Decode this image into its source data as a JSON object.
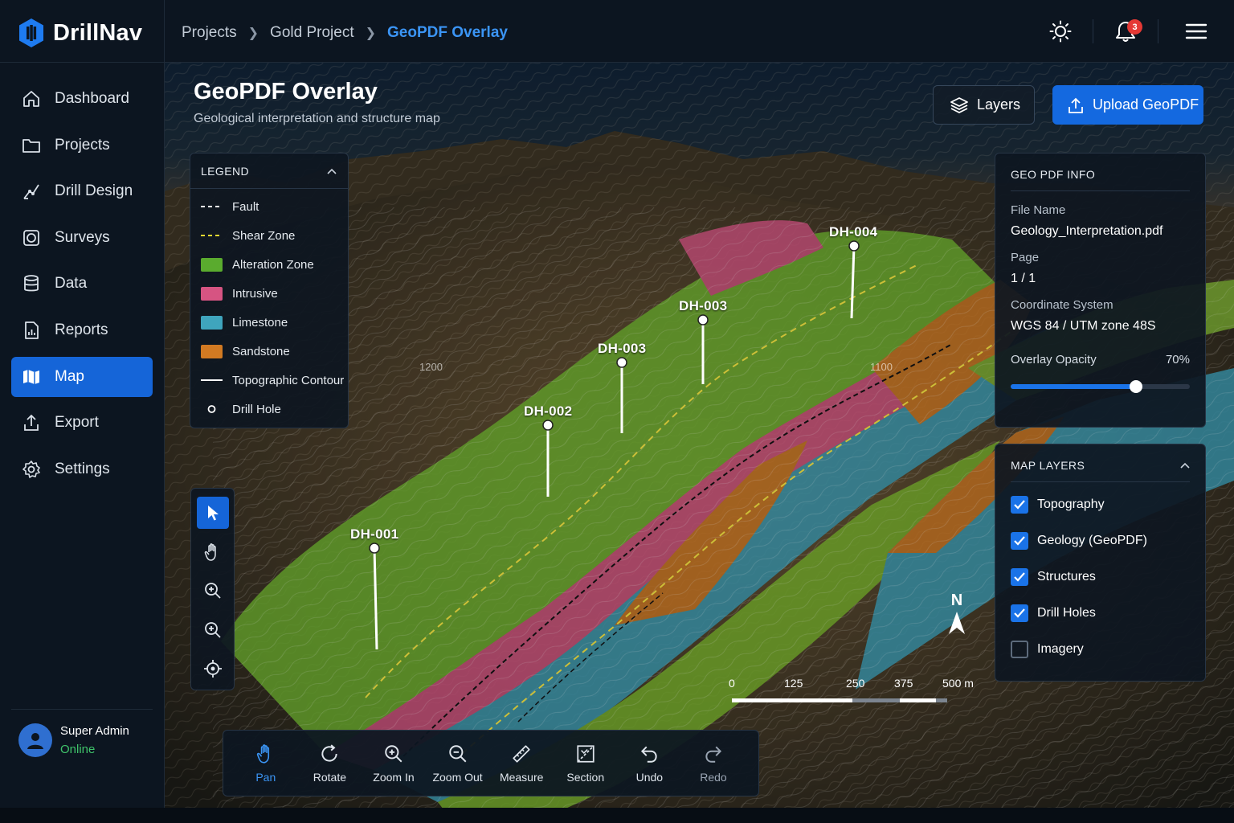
{
  "app": {
    "name": "DrillNav"
  },
  "breadcrumb": [
    "Projects",
    "Gold Project",
    "GeoPDF Overlay"
  ],
  "notifications": {
    "count": "3"
  },
  "sidebar": {
    "items": [
      {
        "label": "Dashboard",
        "icon": "home-icon"
      },
      {
        "label": "Projects",
        "icon": "folder-icon"
      },
      {
        "label": "Drill Design",
        "icon": "drill-design-icon"
      },
      {
        "label": "Surveys",
        "icon": "survey-icon"
      },
      {
        "label": "Data",
        "icon": "database-icon"
      },
      {
        "label": "Reports",
        "icon": "report-icon"
      },
      {
        "label": "Map",
        "icon": "map-icon",
        "active": true
      },
      {
        "label": "Export",
        "icon": "export-icon"
      },
      {
        "label": "Settings",
        "icon": "gear-icon"
      }
    ],
    "user": {
      "name": "Super Admin",
      "status": "Online"
    }
  },
  "page": {
    "title": "GeoPDF Overlay",
    "subtitle": "Geological interpretation and structure map",
    "layers_button": "Layers",
    "upload_button": "Upload GeoPDF"
  },
  "legend": {
    "title": "LEGEND",
    "items": [
      {
        "label": "Fault",
        "kind": "dashed-line",
        "color": "#ffffff"
      },
      {
        "label": "Shear Zone",
        "kind": "dashed-line",
        "color": "#e8d832"
      },
      {
        "label": "Alteration Zone",
        "kind": "fill",
        "color": "#5aab2e"
      },
      {
        "label": "Intrusive",
        "kind": "fill",
        "color": "#d65482"
      },
      {
        "label": "Limestone",
        "kind": "fill",
        "color": "#3fa5bd"
      },
      {
        "label": "Sandstone",
        "kind": "fill",
        "color": "#d27a22"
      },
      {
        "label": "Topographic Contour",
        "kind": "line",
        "color": "#ffffff"
      },
      {
        "label": "Drill Hole",
        "kind": "circle",
        "color": "#ffffff"
      }
    ]
  },
  "geo_info": {
    "title": "GEO PDF INFO",
    "file_name_label": "File Name",
    "file_name": "Geology_Interpretation.pdf",
    "page_label": "Page",
    "page": "1 / 1",
    "crs_label": "Coordinate System",
    "crs": "WGS 84 / UTM zone 48S",
    "opacity_label": "Overlay Opacity",
    "opacity_text": "70%",
    "opacity_value": 0.7
  },
  "map_layers": {
    "title": "MAP LAYERS",
    "items": [
      {
        "label": "Topography",
        "checked": true
      },
      {
        "label": "Geology (GeoPDF)",
        "checked": true
      },
      {
        "label": "Structures",
        "checked": true
      },
      {
        "label": "Drill Holes",
        "checked": true
      },
      {
        "label": "Imagery",
        "checked": false
      }
    ]
  },
  "map_tools": [
    "select-cursor-icon",
    "hand-icon",
    "zoom-in-icon",
    "zoom-out-icon",
    "locate-icon"
  ],
  "toolbar": {
    "items": [
      {
        "label": "Pan",
        "icon": "hand-icon",
        "state": "active"
      },
      {
        "label": "Rotate",
        "icon": "rotate-icon",
        "state": "normal"
      },
      {
        "label": "Zoom In",
        "icon": "zoom-in-icon",
        "state": "normal"
      },
      {
        "label": "Zoom Out",
        "icon": "zoom-out-icon",
        "state": "normal"
      },
      {
        "label": "Measure",
        "icon": "ruler-icon",
        "state": "normal"
      },
      {
        "label": "Section",
        "icon": "section-icon",
        "state": "normal"
      },
      {
        "label": "Undo",
        "icon": "undo-icon",
        "state": "normal"
      },
      {
        "label": "Redo",
        "icon": "redo-icon",
        "state": "disabled"
      }
    ]
  },
  "scale_bar": {
    "labels": [
      "0",
      "125",
      "250",
      "375",
      "500 m"
    ]
  },
  "north_arrow": {
    "label": "N"
  },
  "drill_holes": [
    "DH-001",
    "DH-002",
    "DH-003",
    "DH-003",
    "DH-004"
  ],
  "contour_labels": [
    "1200",
    "1100"
  ],
  "colors": {
    "accent": "#1a73e8",
    "online": "#3fc36a",
    "badge": "#e53935"
  }
}
